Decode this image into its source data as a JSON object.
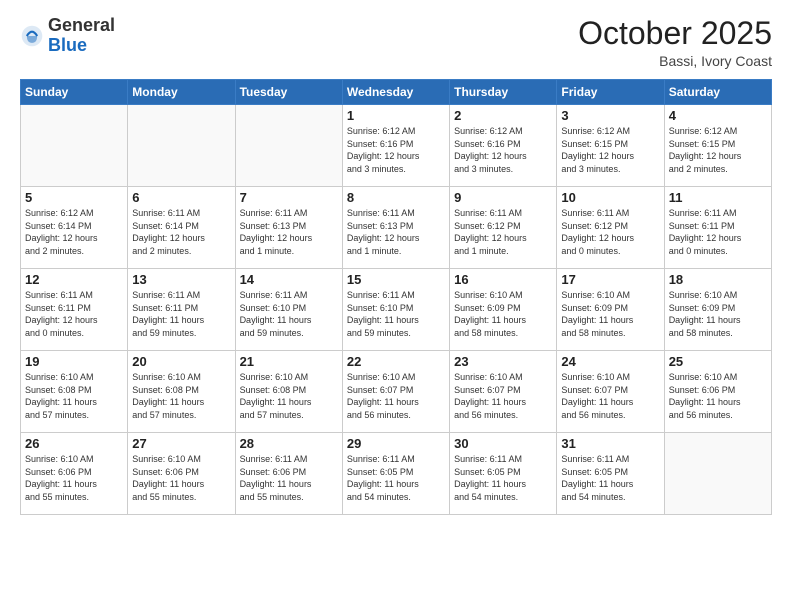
{
  "header": {
    "logo_general": "General",
    "logo_blue": "Blue",
    "month_title": "October 2025",
    "location": "Bassi, Ivory Coast"
  },
  "weekdays": [
    "Sunday",
    "Monday",
    "Tuesday",
    "Wednesday",
    "Thursday",
    "Friday",
    "Saturday"
  ],
  "weeks": [
    [
      {
        "day": "",
        "info": ""
      },
      {
        "day": "",
        "info": ""
      },
      {
        "day": "",
        "info": ""
      },
      {
        "day": "1",
        "info": "Sunrise: 6:12 AM\nSunset: 6:16 PM\nDaylight: 12 hours\nand 3 minutes."
      },
      {
        "day": "2",
        "info": "Sunrise: 6:12 AM\nSunset: 6:16 PM\nDaylight: 12 hours\nand 3 minutes."
      },
      {
        "day": "3",
        "info": "Sunrise: 6:12 AM\nSunset: 6:15 PM\nDaylight: 12 hours\nand 3 minutes."
      },
      {
        "day": "4",
        "info": "Sunrise: 6:12 AM\nSunset: 6:15 PM\nDaylight: 12 hours\nand 2 minutes."
      }
    ],
    [
      {
        "day": "5",
        "info": "Sunrise: 6:12 AM\nSunset: 6:14 PM\nDaylight: 12 hours\nand 2 minutes."
      },
      {
        "day": "6",
        "info": "Sunrise: 6:11 AM\nSunset: 6:14 PM\nDaylight: 12 hours\nand 2 minutes."
      },
      {
        "day": "7",
        "info": "Sunrise: 6:11 AM\nSunset: 6:13 PM\nDaylight: 12 hours\nand 1 minute."
      },
      {
        "day": "8",
        "info": "Sunrise: 6:11 AM\nSunset: 6:13 PM\nDaylight: 12 hours\nand 1 minute."
      },
      {
        "day": "9",
        "info": "Sunrise: 6:11 AM\nSunset: 6:12 PM\nDaylight: 12 hours\nand 1 minute."
      },
      {
        "day": "10",
        "info": "Sunrise: 6:11 AM\nSunset: 6:12 PM\nDaylight: 12 hours\nand 0 minutes."
      },
      {
        "day": "11",
        "info": "Sunrise: 6:11 AM\nSunset: 6:11 PM\nDaylight: 12 hours\nand 0 minutes."
      }
    ],
    [
      {
        "day": "12",
        "info": "Sunrise: 6:11 AM\nSunset: 6:11 PM\nDaylight: 12 hours\nand 0 minutes."
      },
      {
        "day": "13",
        "info": "Sunrise: 6:11 AM\nSunset: 6:11 PM\nDaylight: 11 hours\nand 59 minutes."
      },
      {
        "day": "14",
        "info": "Sunrise: 6:11 AM\nSunset: 6:10 PM\nDaylight: 11 hours\nand 59 minutes."
      },
      {
        "day": "15",
        "info": "Sunrise: 6:11 AM\nSunset: 6:10 PM\nDaylight: 11 hours\nand 59 minutes."
      },
      {
        "day": "16",
        "info": "Sunrise: 6:10 AM\nSunset: 6:09 PM\nDaylight: 11 hours\nand 58 minutes."
      },
      {
        "day": "17",
        "info": "Sunrise: 6:10 AM\nSunset: 6:09 PM\nDaylight: 11 hours\nand 58 minutes."
      },
      {
        "day": "18",
        "info": "Sunrise: 6:10 AM\nSunset: 6:09 PM\nDaylight: 11 hours\nand 58 minutes."
      }
    ],
    [
      {
        "day": "19",
        "info": "Sunrise: 6:10 AM\nSunset: 6:08 PM\nDaylight: 11 hours\nand 57 minutes."
      },
      {
        "day": "20",
        "info": "Sunrise: 6:10 AM\nSunset: 6:08 PM\nDaylight: 11 hours\nand 57 minutes."
      },
      {
        "day": "21",
        "info": "Sunrise: 6:10 AM\nSunset: 6:08 PM\nDaylight: 11 hours\nand 57 minutes."
      },
      {
        "day": "22",
        "info": "Sunrise: 6:10 AM\nSunset: 6:07 PM\nDaylight: 11 hours\nand 56 minutes."
      },
      {
        "day": "23",
        "info": "Sunrise: 6:10 AM\nSunset: 6:07 PM\nDaylight: 11 hours\nand 56 minutes."
      },
      {
        "day": "24",
        "info": "Sunrise: 6:10 AM\nSunset: 6:07 PM\nDaylight: 11 hours\nand 56 minutes."
      },
      {
        "day": "25",
        "info": "Sunrise: 6:10 AM\nSunset: 6:06 PM\nDaylight: 11 hours\nand 56 minutes."
      }
    ],
    [
      {
        "day": "26",
        "info": "Sunrise: 6:10 AM\nSunset: 6:06 PM\nDaylight: 11 hours\nand 55 minutes."
      },
      {
        "day": "27",
        "info": "Sunrise: 6:10 AM\nSunset: 6:06 PM\nDaylight: 11 hours\nand 55 minutes."
      },
      {
        "day": "28",
        "info": "Sunrise: 6:11 AM\nSunset: 6:06 PM\nDaylight: 11 hours\nand 55 minutes."
      },
      {
        "day": "29",
        "info": "Sunrise: 6:11 AM\nSunset: 6:05 PM\nDaylight: 11 hours\nand 54 minutes."
      },
      {
        "day": "30",
        "info": "Sunrise: 6:11 AM\nSunset: 6:05 PM\nDaylight: 11 hours\nand 54 minutes."
      },
      {
        "day": "31",
        "info": "Sunrise: 6:11 AM\nSunset: 6:05 PM\nDaylight: 11 hours\nand 54 minutes."
      },
      {
        "day": "",
        "info": ""
      }
    ]
  ]
}
